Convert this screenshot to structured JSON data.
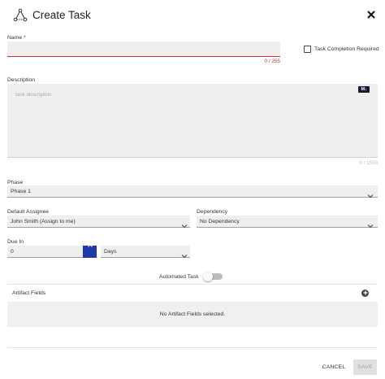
{
  "header": {
    "icon": "workflow-tree-icon",
    "title": "Create Task",
    "close_icon": "close-icon"
  },
  "name": {
    "label": "Name *",
    "value": "",
    "counter": "0 / 255",
    "error_color": "#d32f2f"
  },
  "completion": {
    "label": "Task Completion Required",
    "checked": false
  },
  "description": {
    "label": "Description",
    "placeholder": "task description",
    "badge": "M↓",
    "counter": "0 / 1500"
  },
  "phase": {
    "label": "Phase",
    "selected": "Phase 1"
  },
  "assignee": {
    "label": "Default Assignee",
    "selected": "John Smith (Assign to me)"
  },
  "dependency": {
    "label": "Dependency",
    "selected": "No Dependency"
  },
  "due_in": {
    "label": "Due In",
    "value": "0",
    "unit": "Days",
    "stepper_color": "#1d3aa8"
  },
  "automated": {
    "label": "Automated Task",
    "on": false
  },
  "artifacts": {
    "label": "Artifact Fields",
    "add_icon": "plus-circle-icon",
    "empty_text": "No Artifact Fields selected."
  },
  "footer": {
    "cancel": "CANCEL",
    "save": "SAVE"
  }
}
